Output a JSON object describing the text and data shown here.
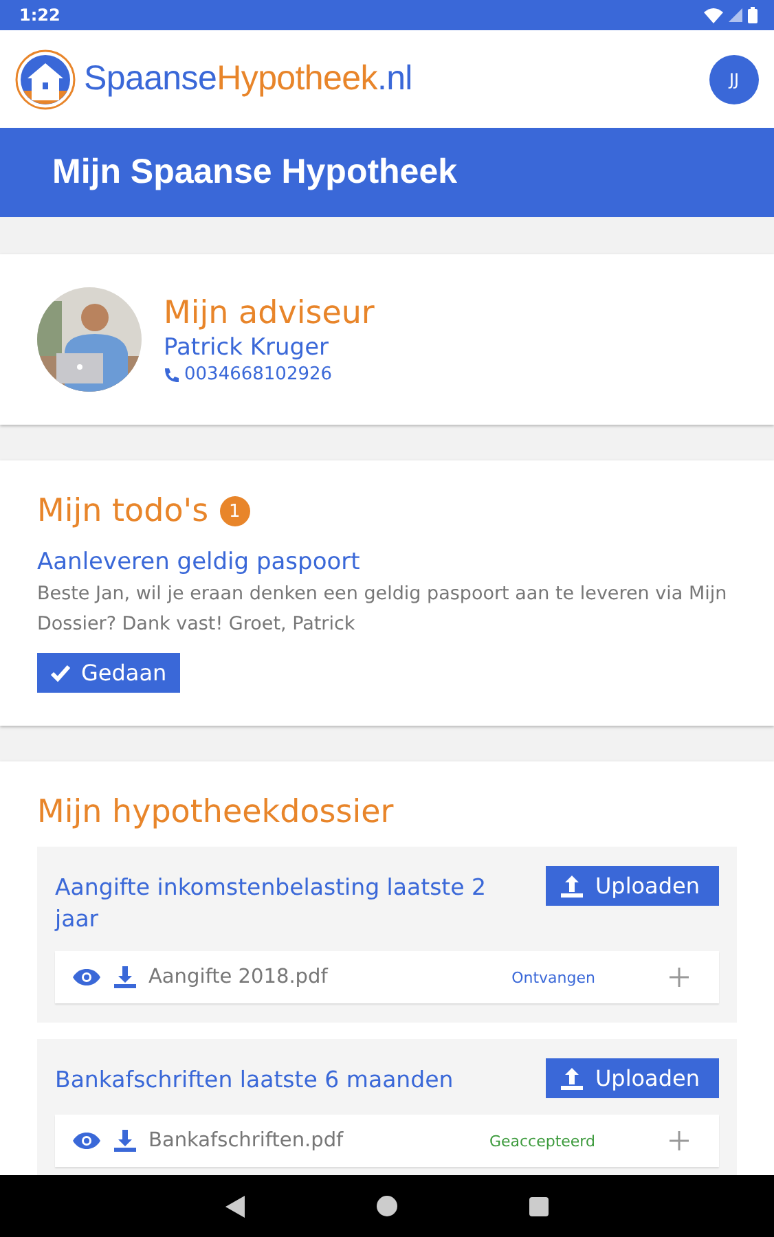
{
  "status_bar": {
    "time": "1:22"
  },
  "header": {
    "logo_part_1": "Spaanse",
    "logo_part_2": "Hypotheek",
    "logo_part_3": ".nl",
    "avatar": "JJ"
  },
  "page_title": "Mijn Spaanse Hypotheek",
  "advisor": {
    "title": "Mijn adviseur",
    "name": "Patrick Kruger",
    "phone": "0034668102926"
  },
  "todos": {
    "title": "Mijn todo's",
    "count": "1",
    "items": [
      {
        "title": "Aanleveren geldig paspoort",
        "text": "Beste Jan, wil je eraan denken een geldig paspoort aan te leveren via Mijn Dossier? Dank vast! Groet, Patrick",
        "button": "Gedaan"
      }
    ]
  },
  "dossier": {
    "title": "Mijn hypotheekdossier",
    "groups": [
      {
        "title": "Aangifte inkomstenbelasting laatste 2 jaar",
        "button": "Uploaden",
        "files": [
          {
            "name": "Aangifte 2018.pdf",
            "status": "Ontvangen",
            "color": "#3a68d8"
          }
        ]
      },
      {
        "title": "Bankafschriften laatste 6 maanden",
        "button": "Uploaden",
        "files": [
          {
            "name": "Bankafschriften.pdf",
            "status": "Geaccepteerd",
            "color": "#3c9a3c"
          }
        ]
      }
    ]
  }
}
